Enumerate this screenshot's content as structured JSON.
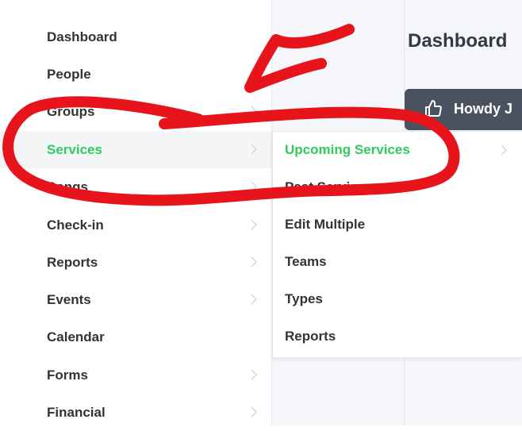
{
  "sidebar": {
    "items": [
      {
        "label": "Dashboard",
        "chevron": false,
        "active": false
      },
      {
        "label": "People",
        "chevron": false,
        "active": false
      },
      {
        "label": "Groups",
        "chevron": true,
        "active": false
      },
      {
        "label": "Services",
        "chevron": true,
        "active": true
      },
      {
        "label": "Songs",
        "chevron": true,
        "active": false
      },
      {
        "label": "Check-in",
        "chevron": true,
        "active": false
      },
      {
        "label": "Reports",
        "chevron": true,
        "active": false
      },
      {
        "label": "Events",
        "chevron": true,
        "active": false
      },
      {
        "label": "Calendar",
        "chevron": false,
        "active": false
      },
      {
        "label": "Forms",
        "chevron": true,
        "active": false
      },
      {
        "label": "Financial",
        "chevron": true,
        "active": false
      }
    ]
  },
  "submenu": {
    "items": [
      {
        "label": "Upcoming Services",
        "chevron": true,
        "active": true
      },
      {
        "label": "Past Services",
        "chevron": false,
        "active": false
      },
      {
        "label": "Edit Multiple",
        "chevron": false,
        "active": false
      },
      {
        "label": "Teams",
        "chevron": false,
        "active": false
      },
      {
        "label": "Types",
        "chevron": false,
        "active": false
      },
      {
        "label": "Reports",
        "chevron": false,
        "active": false
      }
    ]
  },
  "main": {
    "title": "Dashboard",
    "banner_text": "Howdy J",
    "banner_icon": "thumbs-up-icon"
  },
  "colors": {
    "active_text": "#2ecc5b",
    "annotation": "#e8141b",
    "banner_bg": "#4a5260"
  }
}
